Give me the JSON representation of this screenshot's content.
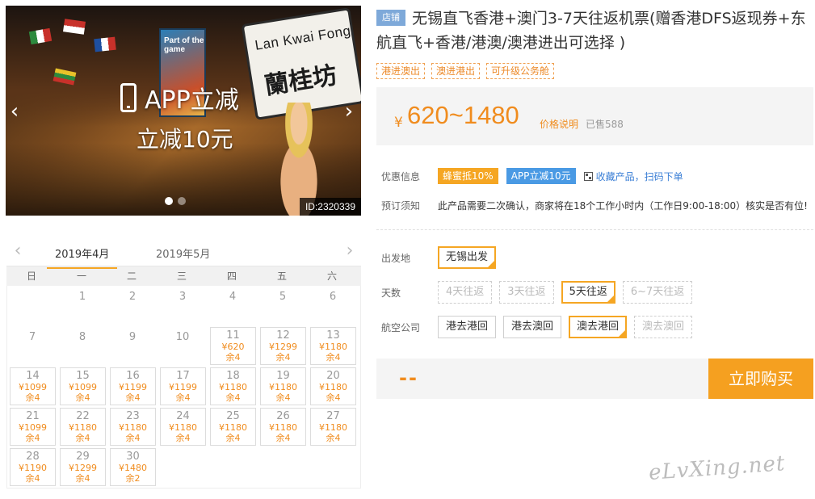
{
  "photo": {
    "overlay_line1": "APP立减",
    "overlay_line2": "立减10元",
    "sign_en": "Lan Kwai Fong",
    "sign_zh": "蘭桂坊",
    "banner_text": "Part of the game",
    "photo_id": "ID:2320339",
    "slide_count": 2,
    "active_slide": 0
  },
  "product": {
    "shop_tag": "店铺",
    "title": "无锡直飞香港+澳门3-7天往返机票(赠香港DFS返现券+东航直飞+香港/港澳/澳港进出可选择 )",
    "tags": [
      "港进澳出",
      "澳进港出",
      "可升级公务舱"
    ]
  },
  "price": {
    "currency": "¥",
    "range": "620~1480",
    "note": "价格说明",
    "sold": "已售588"
  },
  "promo": {
    "label": "优惠信息",
    "badge1": "蜂蜜抵10%",
    "badge2": "APP立减10元",
    "fav": "收藏产品，扫码下单"
  },
  "notice": {
    "label": "预订须知",
    "text": "此产品需要二次确认，商家将在18个工作小时内（工作日9:00-18:00）核实是否有位!"
  },
  "options": {
    "departure": {
      "label": "出发地",
      "items": [
        {
          "text": "无锡出发",
          "state": "selected"
        }
      ]
    },
    "days": {
      "label": "天数",
      "items": [
        {
          "text": "4天往返",
          "state": "disabled"
        },
        {
          "text": "3天往返",
          "state": "disabled"
        },
        {
          "text": "5天往返",
          "state": "selected"
        },
        {
          "text": "6~7天往返",
          "state": "disabled"
        }
      ]
    },
    "airline": {
      "label": "航空公司",
      "items": [
        {
          "text": "港去港回",
          "state": "normal"
        },
        {
          "text": "港去澳回",
          "state": "normal"
        },
        {
          "text": "澳去港回",
          "state": "selected"
        },
        {
          "text": "澳去澳回",
          "state": "disabled"
        }
      ]
    }
  },
  "buy": {
    "qty": "--",
    "button": "立即购买"
  },
  "watermark": "eLvXing.net",
  "calendar": {
    "months": [
      "2019年4月",
      "2019年5月"
    ],
    "active_month": 0,
    "weekdays": [
      "日",
      "一",
      "二",
      "三",
      "四",
      "五",
      "六"
    ],
    "cells": [
      {
        "day": ""
      },
      {
        "day": "1"
      },
      {
        "day": "2"
      },
      {
        "day": "3"
      },
      {
        "day": "4"
      },
      {
        "day": "5"
      },
      {
        "day": "6"
      },
      {
        "day": "7"
      },
      {
        "day": "8"
      },
      {
        "day": "9"
      },
      {
        "day": "10"
      },
      {
        "day": "11",
        "price": "¥620",
        "left": "余4"
      },
      {
        "day": "12",
        "price": "¥1299",
        "left": "余4"
      },
      {
        "day": "13",
        "price": "¥1180",
        "left": "余4"
      },
      {
        "day": "14",
        "price": "¥1099",
        "left": "余4"
      },
      {
        "day": "15",
        "price": "¥1099",
        "left": "余4"
      },
      {
        "day": "16",
        "price": "¥1199",
        "left": "余4"
      },
      {
        "day": "17",
        "price": "¥1199",
        "left": "余4"
      },
      {
        "day": "18",
        "price": "¥1180",
        "left": "余4"
      },
      {
        "day": "19",
        "price": "¥1180",
        "left": "余4"
      },
      {
        "day": "20",
        "price": "¥1180",
        "left": "余4"
      },
      {
        "day": "21",
        "price": "¥1099",
        "left": "余4"
      },
      {
        "day": "22",
        "price": "¥1180",
        "left": "余4"
      },
      {
        "day": "23",
        "price": "¥1180",
        "left": "余4"
      },
      {
        "day": "24",
        "price": "¥1180",
        "left": "余4"
      },
      {
        "day": "25",
        "price": "¥1180",
        "left": "余4"
      },
      {
        "day": "26",
        "price": "¥1180",
        "left": "余4"
      },
      {
        "day": "27",
        "price": "¥1180",
        "left": "余4"
      },
      {
        "day": "28",
        "price": "¥1190",
        "left": "余4"
      },
      {
        "day": "29",
        "price": "¥1299",
        "left": "余4"
      },
      {
        "day": "30",
        "price": "¥1480",
        "left": "余2"
      }
    ]
  },
  "colors": {
    "accent": "#f5a623",
    "price": "#f08c1e",
    "link": "#3b7fd6",
    "shop_tag": "#7ea9d9"
  }
}
